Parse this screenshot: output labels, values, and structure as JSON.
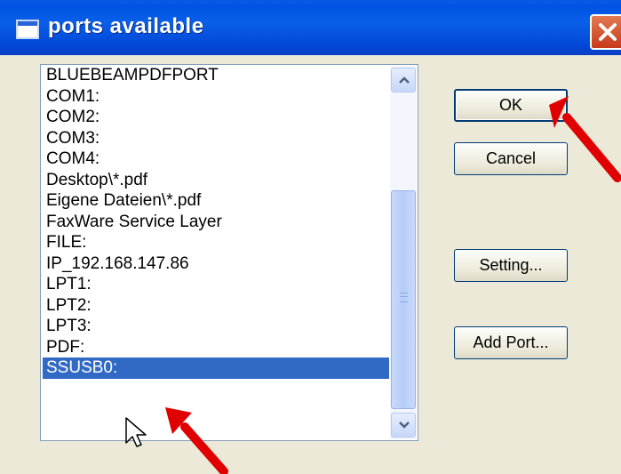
{
  "window": {
    "title": "ports available",
    "close_icon": "close-icon"
  },
  "ports": {
    "items": [
      "BLUEBEAMPDFPORT",
      "COM1:",
      "COM2:",
      "COM3:",
      "COM4:",
      "Desktop\\*.pdf",
      "Eigene Dateien\\*.pdf",
      "FaxWare Service Layer",
      "FILE:",
      "IP_192.168.147.86",
      "LPT1:",
      "LPT2:",
      "LPT3:",
      "PDF:",
      "SSUSB0:"
    ],
    "selected": "SSUSB0:"
  },
  "buttons": {
    "ok": "OK",
    "cancel": "Cancel",
    "setting": "Setting...",
    "add_port": "Add Port..."
  },
  "colors": {
    "selection": "#316ac5",
    "annotation_arrow": "#e00000",
    "titlebar": "#0053e2"
  }
}
